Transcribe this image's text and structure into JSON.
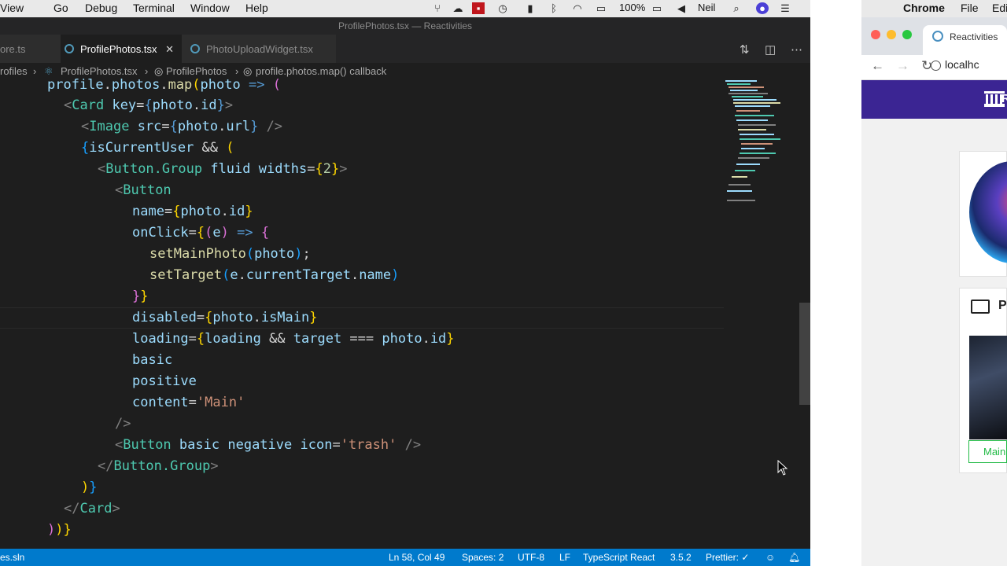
{
  "vscode": {
    "menubar": {
      "items": [
        "View",
        "Go",
        "Debug",
        "Terminal",
        "Window",
        "Help"
      ],
      "battery": "100%",
      "user": "Neil"
    },
    "window_title": "ProfilePhotos.tsx — Reactivities",
    "tabs": [
      {
        "label": "ore.ts"
      },
      {
        "label": "ProfilePhotos.tsx",
        "active": true
      },
      {
        "label": "PhotoUploadWidget.tsx"
      }
    ],
    "breadcrumb": [
      "rofiles",
      "ProfilePhotos.tsx",
      "ProfilePhotos",
      "profile.photos.map() callback"
    ],
    "code_lines": [
      "profile.photos.map(photo => (",
      "<Card key={photo.id}>",
      "<Image src={photo.url} />",
      "{isCurrentUser && (",
      "<Button.Group fluid widths={2}>",
      "<Button",
      "name={photo.id}",
      "onClick={(e) => {",
      "setMainPhoto(photo);",
      "setTarget(e.currentTarget.name)",
      "}}",
      "disabled={photo.isMain}",
      "loading={loading && target === photo.id}",
      "basic",
      "positive",
      "content='Main'",
      "/>",
      "<Button basic negative icon='trash' />",
      "</Button.Group>",
      ")}",
      "</Card>",
      "))}"
    ],
    "statusbar": {
      "left": "es.sln",
      "position": "Ln 58, Col 49",
      "spaces": "Spaces: 2",
      "encoding": "UTF-8",
      "eol": "LF",
      "language": "TypeScript React",
      "version": "3.5.2",
      "prettier": "Prettier: ✓"
    }
  },
  "chrome": {
    "app_name": "Chrome",
    "menu": [
      "File",
      "Edi"
    ],
    "tab_title": "Reactivities",
    "url": "localhc",
    "header_text": "R",
    "photos_title": "P",
    "main_button": "Main"
  },
  "colors": {
    "statusbar": "#007acc",
    "app_header": "#3b2593",
    "positive": "#21ba45"
  }
}
